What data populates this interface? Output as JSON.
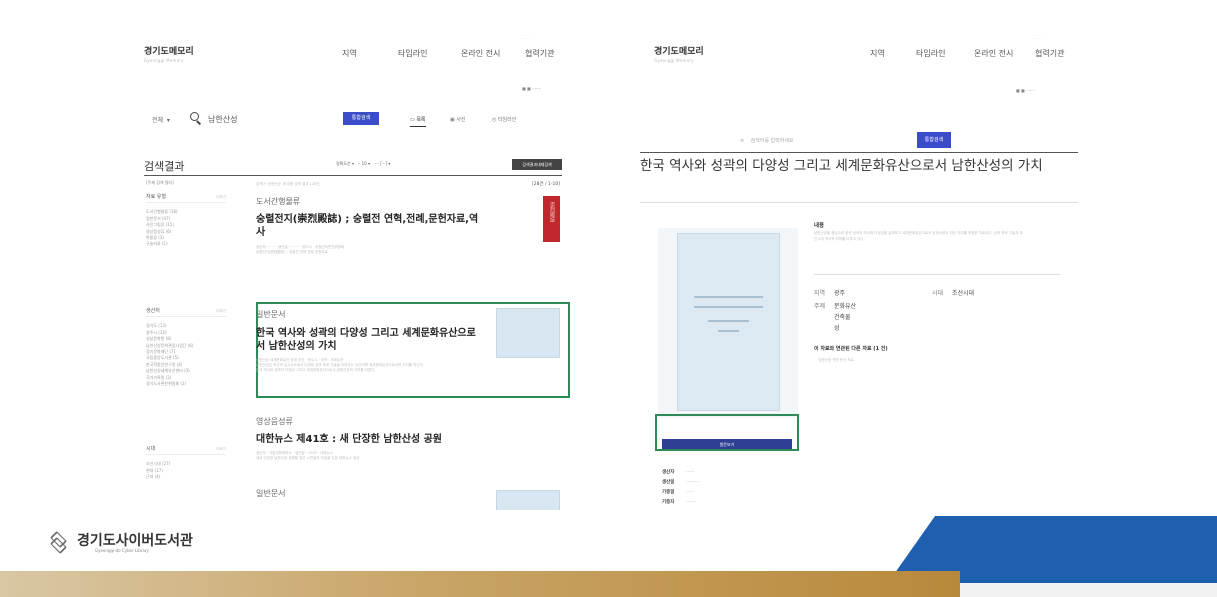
{
  "colors": {
    "accent_blue": "#3a4cc9",
    "navy": "#2e3f94",
    "highlight_green": "#2e8b57",
    "book_red": "#c0282c",
    "footer_gold": "#c9a466",
    "footer_blue": "#1f5fb0"
  },
  "left": {
    "logo": "경기도메모리",
    "nav": [
      "지역",
      "타임라인",
      "온라인 전시",
      "협력기관"
    ],
    "search": {
      "scope": "전체",
      "query": "남한산성",
      "button": "통합검색",
      "tabs": [
        "목록",
        "사진",
        "타임라인"
      ]
    },
    "results_title": "검색결과",
    "sort_button": "검색결과내재검색",
    "count_text": "[28건 / 1-10]",
    "facets": [
      {
        "title": "자료 유형",
        "items": [
          "도서간행물류 (16)",
          "일반문서 (47)",
          "사진그림류 (15)",
          "영상음성류 (6)",
          "박물류 (3)",
          "구술자료 (1)"
        ]
      },
      {
        "title": "생산처",
        "items": [
          "경기도 (13)",
          "광주시 (12)",
          "성남문화원 (8)",
          "남한산성문화관광사업단 (6)",
          "경기문화재단 (7)",
          "국립중앙도서관 (5)",
          "한국학중앙연구원 (4)",
          "남한산성세계유산센터 (3)",
          "국가기록원 (2)",
          "경기도사편찬위원회 (2)"
        ]
      },
      {
        "title": "시대",
        "items": [
          "조선시대 (27)",
          "현대 (17)",
          "근대 (4)"
        ]
      }
    ],
    "results": [
      {
        "category": "도서간행물류",
        "title": "숭렬전지(崇烈殿誌) ; 숭렬전 연혁,전례,문헌자료,역사"
      },
      {
        "category": "일반문서",
        "title": "한국 역사와 성곽의 다양성 그리고 세계문화유산으로서 남한산성의 가치"
      },
      {
        "category": "영상음성류",
        "title": "대한뉴스 제41호 : 새 단장한 남한산성 공원"
      },
      {
        "category": "일반문서",
        "title": ""
      }
    ]
  },
  "right": {
    "logo": "경기도메모리",
    "nav": [
      "지역",
      "타임라인",
      "온라인 전시",
      "협력기관"
    ],
    "search_button": "통합검색",
    "detail_title": "한국 역사와 성곽의 다양성 그리고 세계문화유산으로서 남한산성의 가치",
    "content_label": "내용",
    "fields": {
      "region_label": "지역",
      "region": "광주",
      "era_label": "시대",
      "era": "조선시대",
      "subject_label": "주제",
      "subjects": [
        "문화유산",
        "건축물",
        "성"
      ]
    },
    "related": "이 자료와 연관된 다른 자료 (1 건)",
    "view_button": "원문보기",
    "meta_labels": [
      "생산자",
      "생산일",
      "기증일",
      "기증자"
    ]
  },
  "footer": {
    "logo_name": "경기도사이버도서관",
    "logo_sub": "Gyeonggi-do Cyber Library"
  }
}
